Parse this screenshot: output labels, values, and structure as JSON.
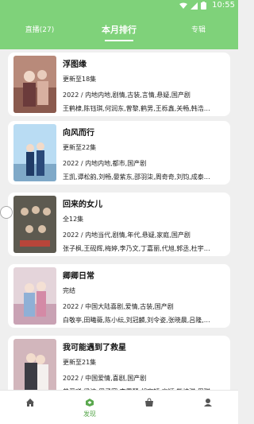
{
  "status_bar": {
    "time": "10:55"
  },
  "tabs": [
    {
      "label": "直播(27)"
    },
    {
      "label": "本月排行"
    },
    {
      "label": "专辑"
    }
  ],
  "list": [
    {
      "title": "浮图缘",
      "status": "更新至18集",
      "meta": "2022 / 内地内地,剧情,古装,言情,悬疑,国产剧",
      "cast": "王鹤棣,陈钰琪,何润东,曾黎,鹤男,王栎鑫,关畅,韩浩…",
      "poster_color": "#b88a7a"
    },
    {
      "title": "向风而行",
      "status": "更新至22集",
      "meta": "2022 / 内地内地,都市,国产剧",
      "cast": "王凯,谭松韵,刘畅,晏紫东,邵羽柒,周奇奇,刘钧,成泰…",
      "poster_color": "#9bc7e8"
    },
    {
      "title": "回来的女儿",
      "status": "全12集",
      "meta": "2022 / 内地当代,剧情,年代,悬疑,家庭,国产剧",
      "cast": "张子枫,王砚辉,梅婷,李乃文,丁嘉丽,代旭,郭丞,杜宇…",
      "poster_color": "#6d6a5e"
    },
    {
      "title": "卿卿日常",
      "status": "完结",
      "meta": "2022 / 中国大陆喜剧,爱情,古装,国产剧",
      "cast": "白敬亭,田曦薇,陈小纭,刘冠麟,刘令姿,张晓晨,吕隆,…",
      "poster_color": "#d8c2cc"
    },
    {
      "title": "我可能遇到了救星",
      "status": "更新至21集",
      "meta": "2022 / 中国爱情,喜剧,国产剧",
      "cast": "曾舜晞,梁洁,周子寒,李雪琴,胡宇轩,高颖,熊梓淇,周琪…",
      "poster_color": "#c7a6b0"
    }
  ],
  "bottom_nav": [
    {
      "label": "",
      "icon": "home-icon"
    },
    {
      "label": "发现",
      "icon": "discover-icon"
    },
    {
      "label": "",
      "icon": "bag-icon"
    },
    {
      "label": "",
      "icon": "user-icon"
    }
  ],
  "colors": {
    "accent": "#7fd27a",
    "nav_active": "#5aa84e",
    "background": "#efefef"
  }
}
